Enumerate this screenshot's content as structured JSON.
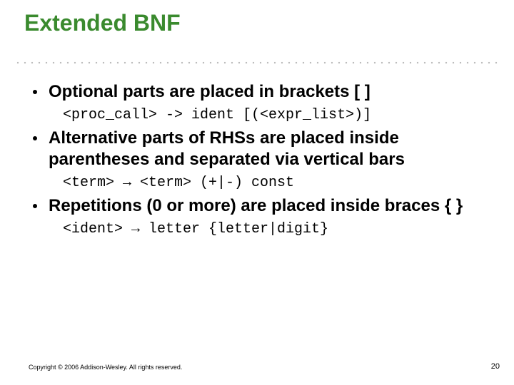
{
  "title": "Extended BNF",
  "bullets": [
    {
      "text": "Optional parts are placed in brackets [ ]",
      "code": "<proc_call> -> ident [(<expr_list>)]"
    },
    {
      "text": "Alternative parts of RHSs are placed inside parentheses and separated via vertical bars",
      "code": "<term> → <term> (+|-) const"
    },
    {
      "text": "Repetitions (0 or more) are placed inside braces { }",
      "code": "<ident> → letter {letter|digit}"
    }
  ],
  "copyright": "Copyright © 2006 Addison-Wesley. All rights reserved.",
  "page_number": "20"
}
